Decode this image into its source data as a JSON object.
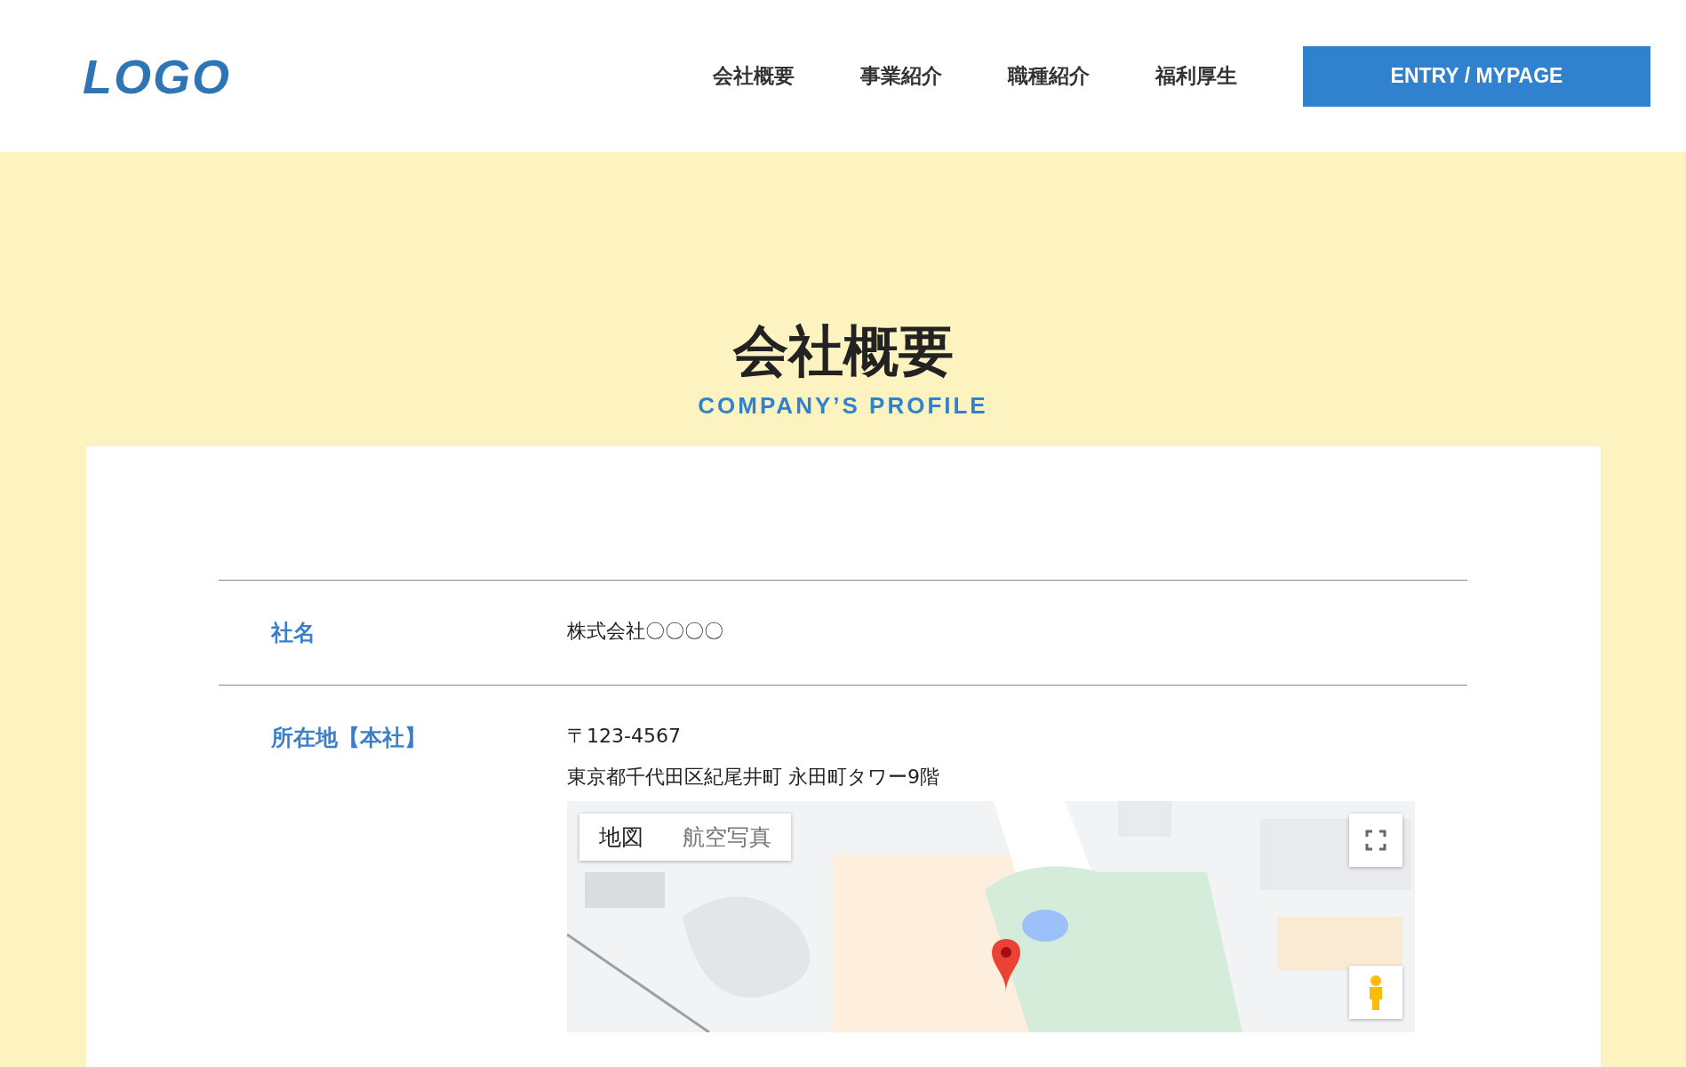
{
  "header": {
    "logo": "LOGO",
    "nav": [
      {
        "label": "会社概要"
      },
      {
        "label": "事業紹介"
      },
      {
        "label": "職種紹介"
      },
      {
        "label": "福利厚生"
      }
    ],
    "entry_button": "ENTRY / MYPAGE"
  },
  "hero": {
    "title": "会社概要",
    "subtitle": "COMPANY’S PROFILE"
  },
  "profile": {
    "rows": [
      {
        "label": "社名",
        "lines": [
          "株式会社〇〇〇〇"
        ]
      },
      {
        "label": "所在地【本社】",
        "lines": [
          "〒123-4567",
          "東京都千代田区紀尾井町 永田町タワー9階"
        ],
        "map": {
          "tabs": [
            {
              "label": "地図",
              "selected": true
            },
            {
              "label": "航空写真",
              "selected": false
            }
          ]
        }
      }
    ]
  }
}
